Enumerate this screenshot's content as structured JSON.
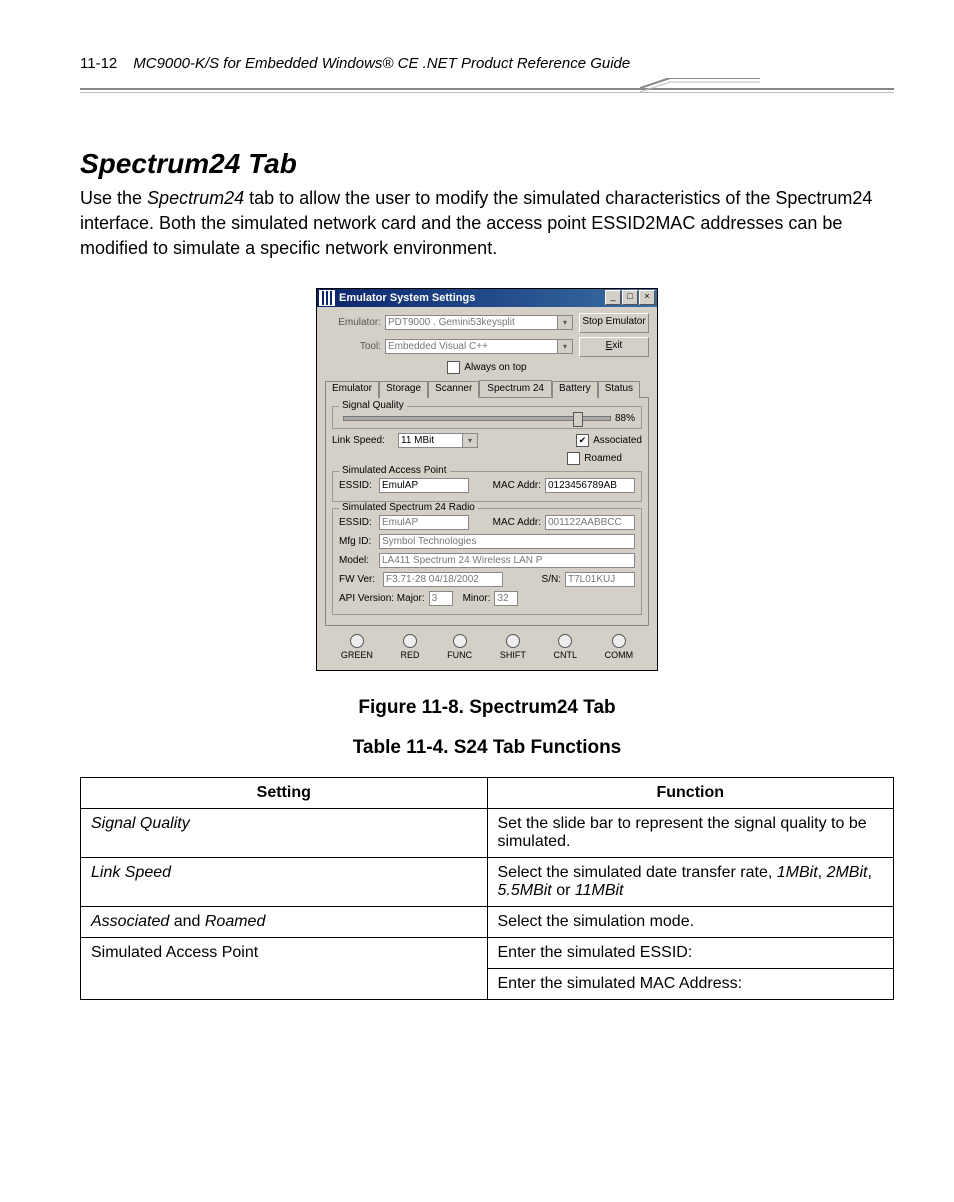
{
  "header": {
    "page_number": "11-12",
    "doc_title": "MC9000-K/S for Embedded Windows® CE .NET Product Reference Guide"
  },
  "section": {
    "heading": "Spectrum24 Tab",
    "para_prefix": "Use the ",
    "para_em": "Spectrum24",
    "para_suffix": " tab to allow the user to modify the simulated characteristics of the Spectrum24 interface. Both the simulated network card and the access point ESSID2MAC addresses can be modified to simulate a specific network environment."
  },
  "dialog": {
    "title": "Emulator System Settings",
    "emulator_label": "Emulator:",
    "emulator_value": "PDT9000 . Gemini53keysplit",
    "tool_label": "Tool:",
    "tool_value": "Embedded Visual C++",
    "stop_btn": "Stop Emulator",
    "exit_btn": "Exit",
    "always_on_top": "Always on top",
    "tabs": [
      "Emulator",
      "Storage",
      "Scanner",
      "Spectrum 24",
      "Battery",
      "Status"
    ],
    "active_tab_index": 3,
    "signal_quality_label": "Signal Quality",
    "signal_quality_value": "88%",
    "link_speed_label": "Link Speed:",
    "link_speed_value": "11 MBit",
    "associated_label": "Associated",
    "associated_checked": true,
    "roamed_label": "Roamed",
    "ap_group": "Simulated Access Point",
    "ap_essid_label": "ESSID:",
    "ap_essid_value": "EmulAP",
    "ap_mac_label": "MAC Addr:",
    "ap_mac_value": "0123456789AB",
    "radio_group": "Simulated Spectrum 24 Radio",
    "radio_essid_label": "ESSID:",
    "radio_essid_value": "EmulAP",
    "radio_mac_label": "MAC Addr:",
    "radio_mac_value": "001122AABBCC",
    "mfg_label": "Mfg ID:",
    "mfg_value": "Symbol Technologies",
    "model_label": "Model:",
    "model_value": "LA411 Spectrum 24 Wireless LAN P",
    "fw_label": "FW Ver:",
    "fw_value": "F3.71-28 04/18/2002",
    "sn_label": "S/N:",
    "sn_value": "T7L01KUJ",
    "api_label": "API Version:   Major:",
    "api_major": "3",
    "api_minor_label": "Minor:",
    "api_minor": "32",
    "indicators": [
      "GREEN",
      "RED",
      "FUNC",
      "SHIFT",
      "CNTL",
      "COMM"
    ]
  },
  "figure_caption": "Figure 11-8.  Spectrum24 Tab",
  "table_caption": "Table 11-4. S24 Tab Functions",
  "table": {
    "headers": [
      "Setting",
      "Function"
    ],
    "rows": [
      {
        "setting_em": "Signal Quality",
        "setting_plain": "",
        "func_pre": "Set the slide bar to represent the signal quality to be simulated.",
        "func_ems": []
      },
      {
        "setting_em": " Link Speed",
        "setting_plain": "",
        "func_pre": "Select the simulated date transfer rate, ",
        "func_ems": [
          "1MBit",
          ", ",
          "2MBit",
          ", ",
          "5.5MBit",
          " or ",
          "11MBit"
        ]
      },
      {
        "setting_em": "Associated",
        "setting_mid": " and ",
        "setting_em2": "Roamed",
        "func_pre": "Select the simulation mode.",
        "func_ems": []
      },
      {
        "setting_plain": "Simulated Access Point",
        "func_pre": "Enter the simulated ESSID:",
        "func_ems": []
      },
      {
        "setting_plain": "",
        "blank_first": true,
        "func_pre": "Enter the simulated MAC Address:",
        "func_ems": []
      }
    ]
  }
}
